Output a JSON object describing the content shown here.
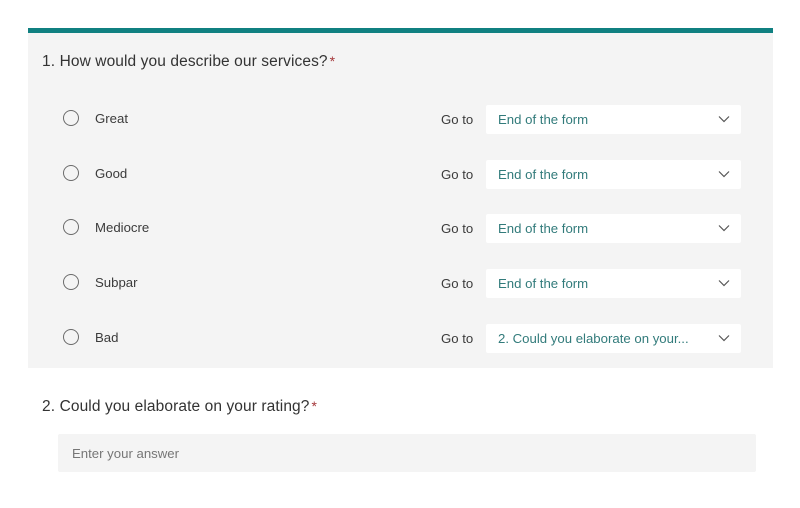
{
  "theme": {
    "accent_color": "#108081",
    "card_background": "#f4f4f4",
    "page_background": "#ffffff",
    "required_marker_color": "#a4373a",
    "dropdown_text_color": "#327b7b"
  },
  "questions": [
    {
      "number": "1.",
      "title": "How would you describe our services?",
      "required_marker": "*",
      "type": "multiple-choice-with-branching",
      "branching_label": "Go to",
      "options": [
        {
          "label": "Great",
          "goto_label": "Go to",
          "branch_target": "End of the form"
        },
        {
          "label": "Good",
          "goto_label": "Go to",
          "branch_target": "End of the form"
        },
        {
          "label": "Mediocre",
          "goto_label": "Go to",
          "branch_target": "End of the form"
        },
        {
          "label": "Subpar",
          "goto_label": "Go to",
          "branch_target": "End of the form"
        },
        {
          "label": "Bad",
          "goto_label": "Go to",
          "branch_target": "2. Could you elaborate on your..."
        }
      ]
    },
    {
      "number": "2.",
      "title": "Could you elaborate on your rating?",
      "required_marker": "*",
      "type": "text",
      "answer_value": "",
      "answer_placeholder": "Enter your answer"
    }
  ],
  "icons": {
    "chevron_down": "chevron-down-icon",
    "radio": "radio-button-icon"
  }
}
